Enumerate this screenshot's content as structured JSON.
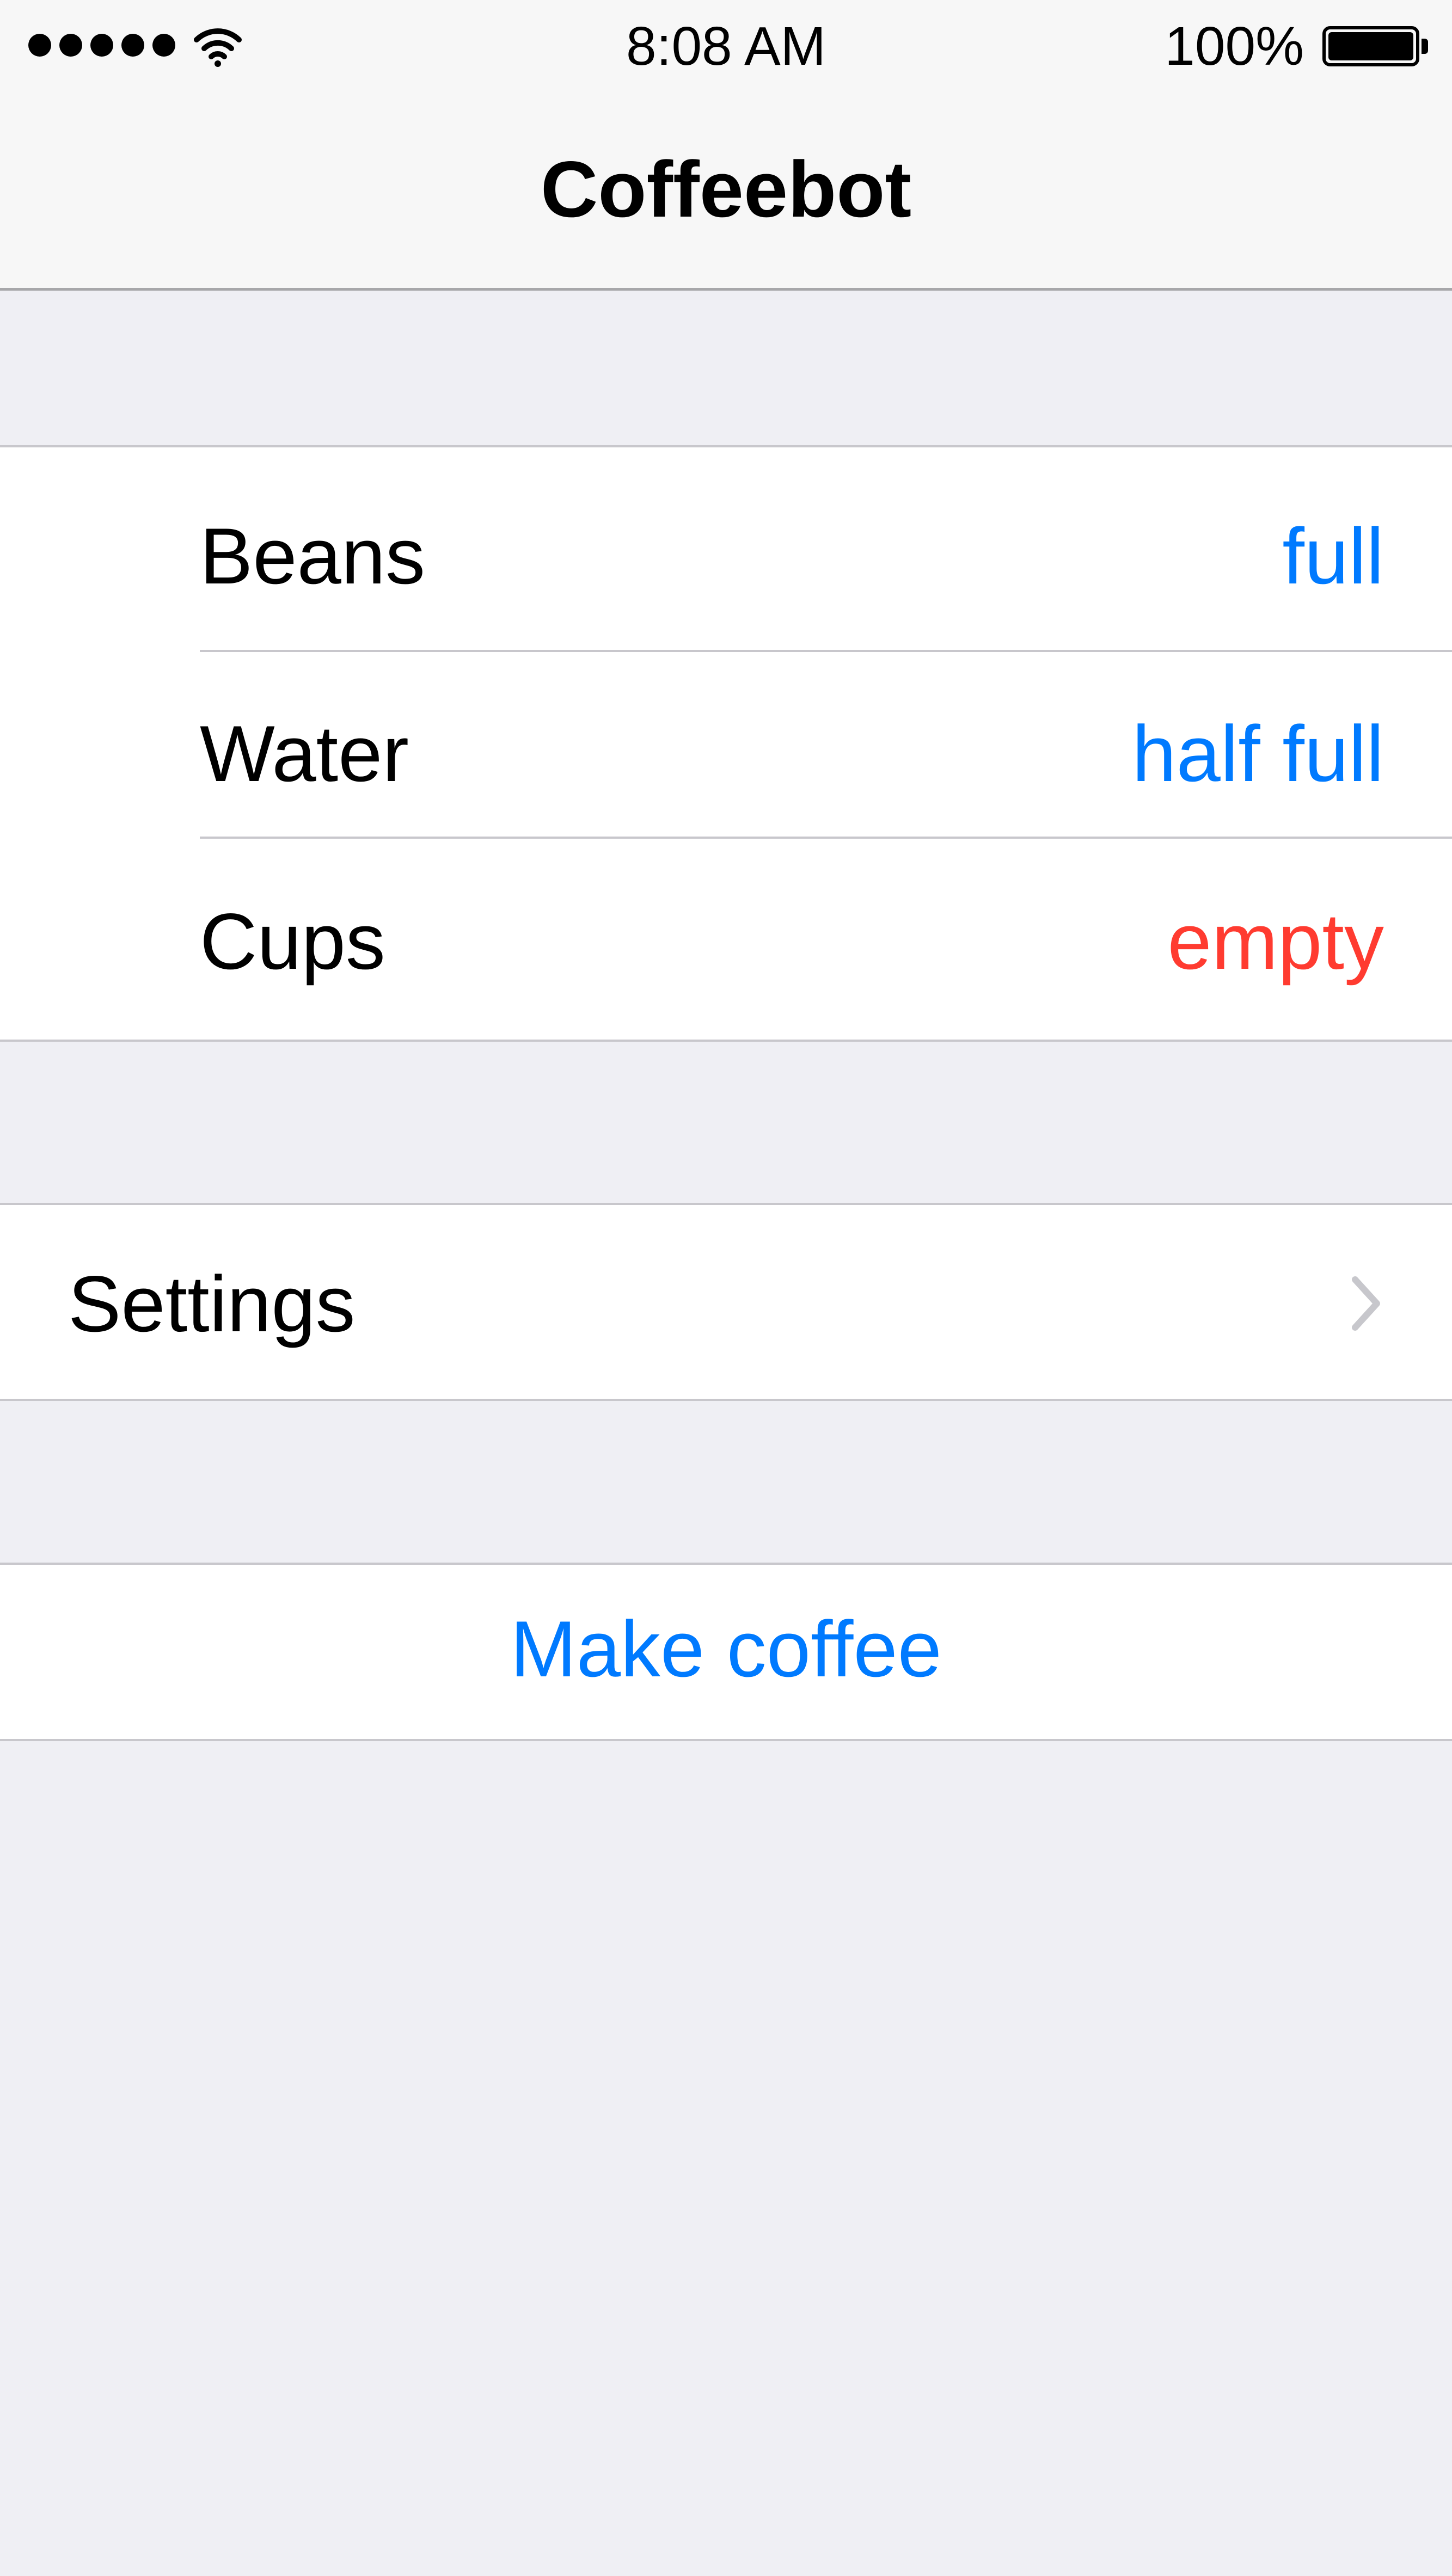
{
  "status_bar": {
    "signal_dots": 5,
    "signal_icon": "cellular-signal-icon",
    "wifi_icon": "wifi-icon",
    "time": "8:08 AM",
    "battery_percent": "100%",
    "battery_level": 1.0,
    "battery_icon": "battery-icon"
  },
  "nav": {
    "title": "Coffeebot"
  },
  "status_group": {
    "rows": [
      {
        "label": "Beans",
        "value": "full",
        "value_color": "#007aff"
      },
      {
        "label": "Water",
        "value": "half full",
        "value_color": "#007aff"
      },
      {
        "label": "Cups",
        "value": "empty",
        "value_color": "#ff3b30"
      }
    ]
  },
  "settings_group": {
    "label": "Settings",
    "accessory_icon": "chevron-right-icon"
  },
  "action_group": {
    "label": "Make coffee"
  },
  "colors": {
    "tint": "#007aff",
    "warning": "#ff3b30",
    "background": "#efeff4",
    "separator": "#c8c7cc",
    "chevron": "#c7c7cc"
  }
}
